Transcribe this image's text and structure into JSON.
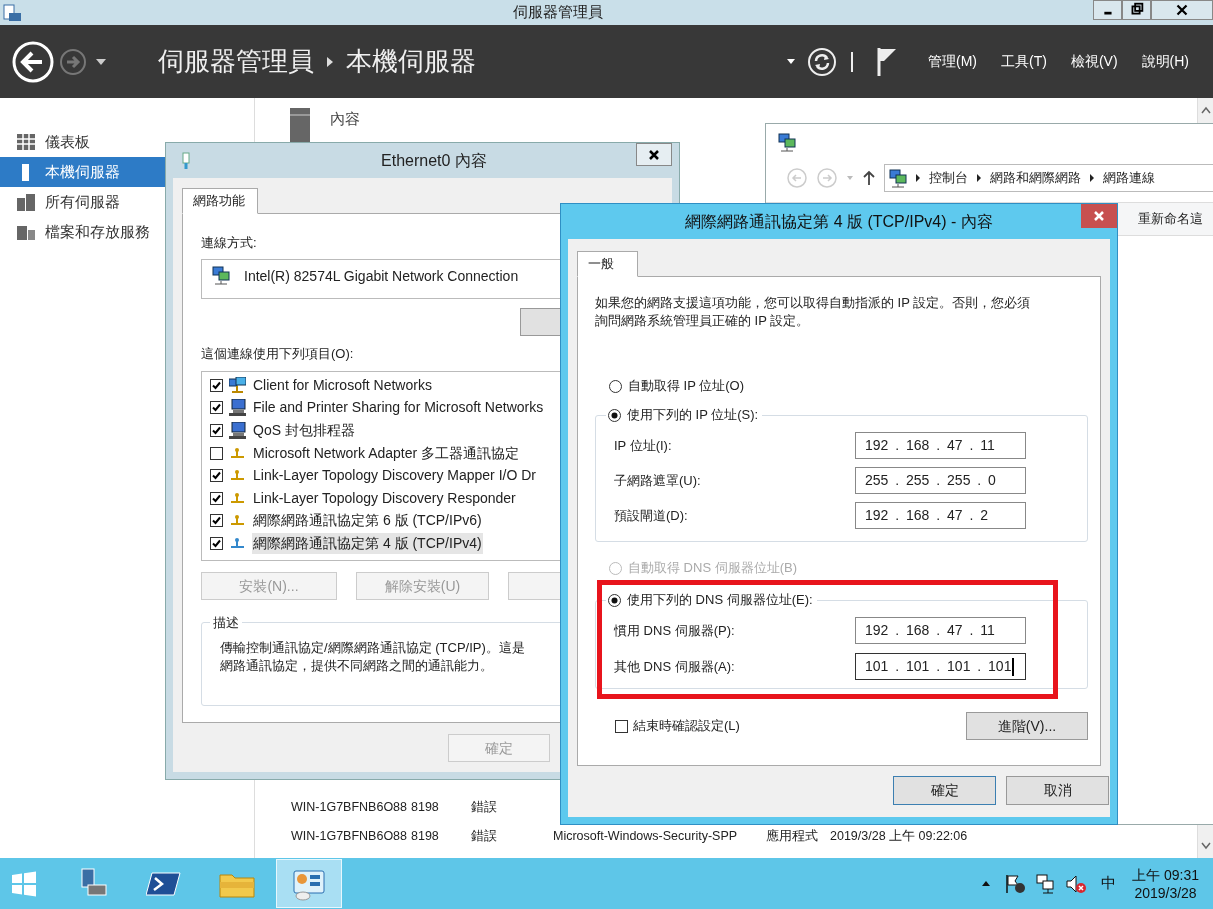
{
  "window": {
    "title": "伺服器管理員"
  },
  "header": {
    "breadcrumb": [
      "伺服器管理員",
      "本機伺服器"
    ],
    "menus": [
      "管理(M)",
      "工具(T)",
      "檢視(V)",
      "說明(H)"
    ]
  },
  "sidebar": {
    "items": [
      {
        "label": "儀表板",
        "kind": "dashboard",
        "selected": false
      },
      {
        "label": "本機伺服器",
        "kind": "local",
        "selected": true
      },
      {
        "label": "所有伺服器",
        "kind": "servers",
        "selected": false
      },
      {
        "label": "檔案和存放服務",
        "kind": "files",
        "selected": false
      }
    ]
  },
  "properties": {
    "title": "內容"
  },
  "events": {
    "rows": [
      [
        "WIN-1G7BFNB6O88",
        "8198",
        "錯誤"
      ],
      [
        "WIN-1G7BFNB6O88",
        "8198",
        "錯誤",
        "Microsoft-Windows-Security-SPP",
        "應用程式",
        "2019/3/28 上午 09:22:06"
      ]
    ]
  },
  "network_window": {
    "address": [
      "控制台",
      "網路和網際網路",
      "網路連線"
    ],
    "toolbar": [
      "重新命名這"
    ]
  },
  "ethernet_dialog": {
    "title": "Ethernet0 內容",
    "tabs": [
      {
        "label": "網路功能",
        "selected": true
      }
    ],
    "connect_label": "連線方式:",
    "adapter": "Intel(R) 82574L Gigabit Network Connection",
    "items_label": "這個連線使用下列項目(O):",
    "items": [
      {
        "label": "Client for Microsoft Networks",
        "kind": "client",
        "checked": true,
        "selected": false
      },
      {
        "label": "File and Printer Sharing for Microsoft Networks",
        "kind": "computer",
        "checked": true,
        "selected": false
      },
      {
        "label": "QoS 封包排程器",
        "kind": "computer",
        "checked": true,
        "selected": false
      },
      {
        "label": "Microsoft Network Adapter 多工器通訊協定",
        "kind": "protocol",
        "checked": false,
        "selected": false
      },
      {
        "label": "Link-Layer Topology Discovery Mapper I/O Dr",
        "kind": "protocol",
        "checked": true,
        "selected": false
      },
      {
        "label": "Link-Layer Topology Discovery Responder",
        "kind": "protocol",
        "checked": true,
        "selected": false
      },
      {
        "label": "網際網路通訊協定第 6 版 (TCP/IPv6)",
        "kind": "protocol",
        "checked": true,
        "selected": false
      },
      {
        "label": "網際網路通訊協定第 4 版 (TCP/IPv4)",
        "kind": "protocol",
        "checked": true,
        "selected": true
      }
    ],
    "buttons": [
      {
        "label": "安裝(N)...",
        "disabled": true
      },
      {
        "label": "解除安裝(U)",
        "disabled": true
      },
      {
        "disabled": true
      }
    ],
    "description_title": "描述",
    "description_lines": [
      "傳輸控制通訊協定/網際網路通訊協定 (TCP/IP)。這是",
      "網路通訊協定，提供不同網路之間的通訊能力。"
    ],
    "ok": {
      "label": "確定",
      "disabled": true
    }
  },
  "ipv4_dialog": {
    "title": "網際網路通訊協定第 4 版 (TCP/IPv4) - 內容",
    "tabs": [
      {
        "label": "一般",
        "selected": true
      }
    ],
    "intro_lines": [
      "如果您的網路支援這項功能，您可以取得自動指派的 IP 設定。否則，您必須",
      "詢問網路系統管理員正確的 IP 設定。"
    ],
    "ip_modes": [
      {
        "label": "自動取得 IP 位址(O)",
        "selected": false,
        "disabled": false
      },
      {
        "label": "使用下列的 IP 位址(S):",
        "selected": true,
        "disabled": false
      }
    ],
    "ip_fields": [
      {
        "label": "IP 位址(I):",
        "value": "192 . 168 . 47 . 11",
        "focused": false
      },
      {
        "label": "子網路遮罩(U):",
        "value": "255 . 255 . 255 . 0",
        "focused": false
      },
      {
        "label": "預設閘道(D):",
        "value": "192 . 168 . 47 . 2",
        "focused": false
      }
    ],
    "dns_modes": [
      {
        "label": "自動取得 DNS 伺服器位址(B)",
        "selected": false,
        "disabled": true
      },
      {
        "label": "使用下列的 DNS 伺服器位址(E):",
        "selected": true,
        "disabled": false
      }
    ],
    "dns_fields": [
      {
        "label": "慣用 DNS 伺服器(P):",
        "value": "192 . 168 . 47 . 11",
        "focused": false
      },
      {
        "label": "其他 DNS 伺服器(A):",
        "value": "101 . 101 . 101 . 101",
        "focused": true
      }
    ],
    "validate": {
      "label": "結束時確認設定(L)",
      "checked": false
    },
    "advanced": "進階(V)...",
    "ok": "確定",
    "cancel": "取消"
  },
  "taskbar": {
    "apps": [
      {
        "kind": "server-manager",
        "selected": false
      },
      {
        "kind": "powershell",
        "selected": false
      },
      {
        "kind": "explorer",
        "selected": false
      },
      {
        "kind": "control-panel",
        "selected": true
      }
    ],
    "ime": "中",
    "time": "上午 09:31",
    "date": "2019/3/28"
  }
}
